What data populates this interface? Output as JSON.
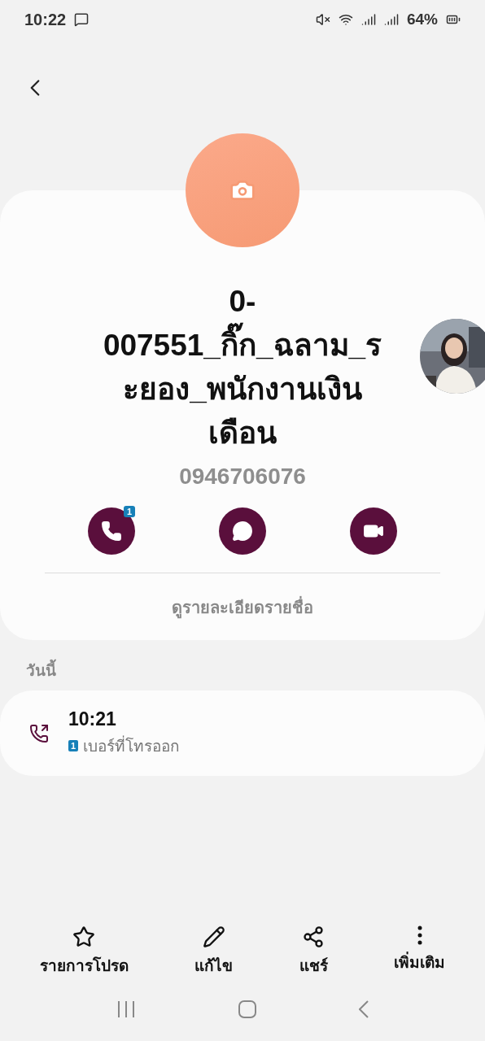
{
  "status_bar": {
    "time": "10:22",
    "battery": "64%"
  },
  "contact": {
    "name": "0-007551_กิ๊ก_ฉลาม_ระยอง_พนักงานเงินเดือน",
    "phone": "0946706076",
    "actions": [
      {
        "kind": "call",
        "badge": "1"
      },
      {
        "kind": "message"
      },
      {
        "kind": "video"
      }
    ],
    "details_link": "ดูรายละเอียดรายชื่อ"
  },
  "history": {
    "section": "วันนี้",
    "entries": [
      {
        "time": "10:21",
        "sim": "1",
        "type": "เบอร์ที่โทรออก"
      }
    ]
  },
  "bottom_actions": [
    {
      "kind": "star",
      "label": "รายการโปรด"
    },
    {
      "kind": "edit",
      "label": "แก้ไข"
    },
    {
      "kind": "share",
      "label": "แชร์"
    },
    {
      "kind": "more",
      "label": "เพิ่มเติม"
    }
  ]
}
